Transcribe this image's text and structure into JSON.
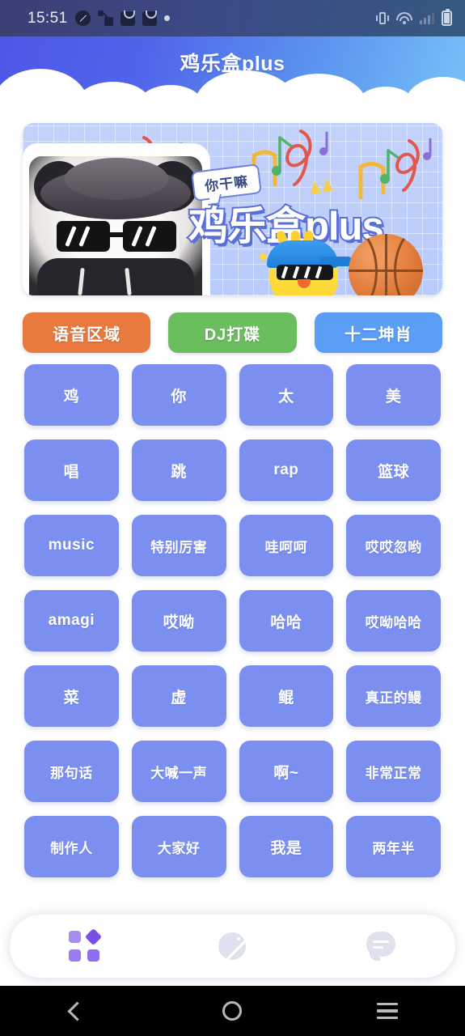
{
  "statusbar": {
    "time": "15:51",
    "left_icons": [
      "compass-icon",
      "share-icon",
      "bag-icon",
      "bag-icon",
      "dot-icon"
    ],
    "right_icons": [
      "vibrate-icon",
      "wifi-icon",
      "signal-icon",
      "battery-icon"
    ]
  },
  "header": {
    "title": "鸡乐盒plus",
    "gradient_from": "#4d57e8",
    "gradient_to": "#77c2f7"
  },
  "banner": {
    "title": "鸡乐盒plus",
    "bubble_text": "你干嘛",
    "background": "#bccdfa",
    "decorations": [
      "panda-sticker",
      "chick-mascot",
      "basketball",
      "music-notes"
    ]
  },
  "tabs": [
    {
      "label": "语音区域",
      "color": "#e8793f",
      "active": true
    },
    {
      "label": "DJ打碟",
      "color": "#6bbe5e",
      "active": false
    },
    {
      "label": "十二坤肖",
      "color": "#5b9ef5",
      "active": false
    }
  ],
  "grid": {
    "button_color": "#7b8ff0",
    "buttons": [
      "鸡",
      "你",
      "太",
      "美",
      "唱",
      "跳",
      "rap",
      "篮球",
      "music",
      "特别厉害",
      "哇呵呵",
      "哎哎忽哟",
      "amagi",
      "哎呦",
      "哈哈",
      "哎呦哈哈",
      "菜",
      "虚",
      "鲲",
      "真正的鳗",
      "那句话",
      "大喊一声",
      "啊~",
      "非常正常",
      "制作人",
      "大家好",
      "我是",
      "两年半"
    ]
  },
  "bottom_nav": {
    "items": [
      {
        "icon": "apps-grid-icon",
        "active": true
      },
      {
        "icon": "planet-icon",
        "active": false
      },
      {
        "icon": "chat-bubble-icon",
        "active": false
      }
    ],
    "active_color": "#8f6df0",
    "inactive_color": "#dfe2ee"
  },
  "android_nav": {
    "items": [
      "back-icon",
      "home-icon",
      "recents-icon"
    ]
  }
}
